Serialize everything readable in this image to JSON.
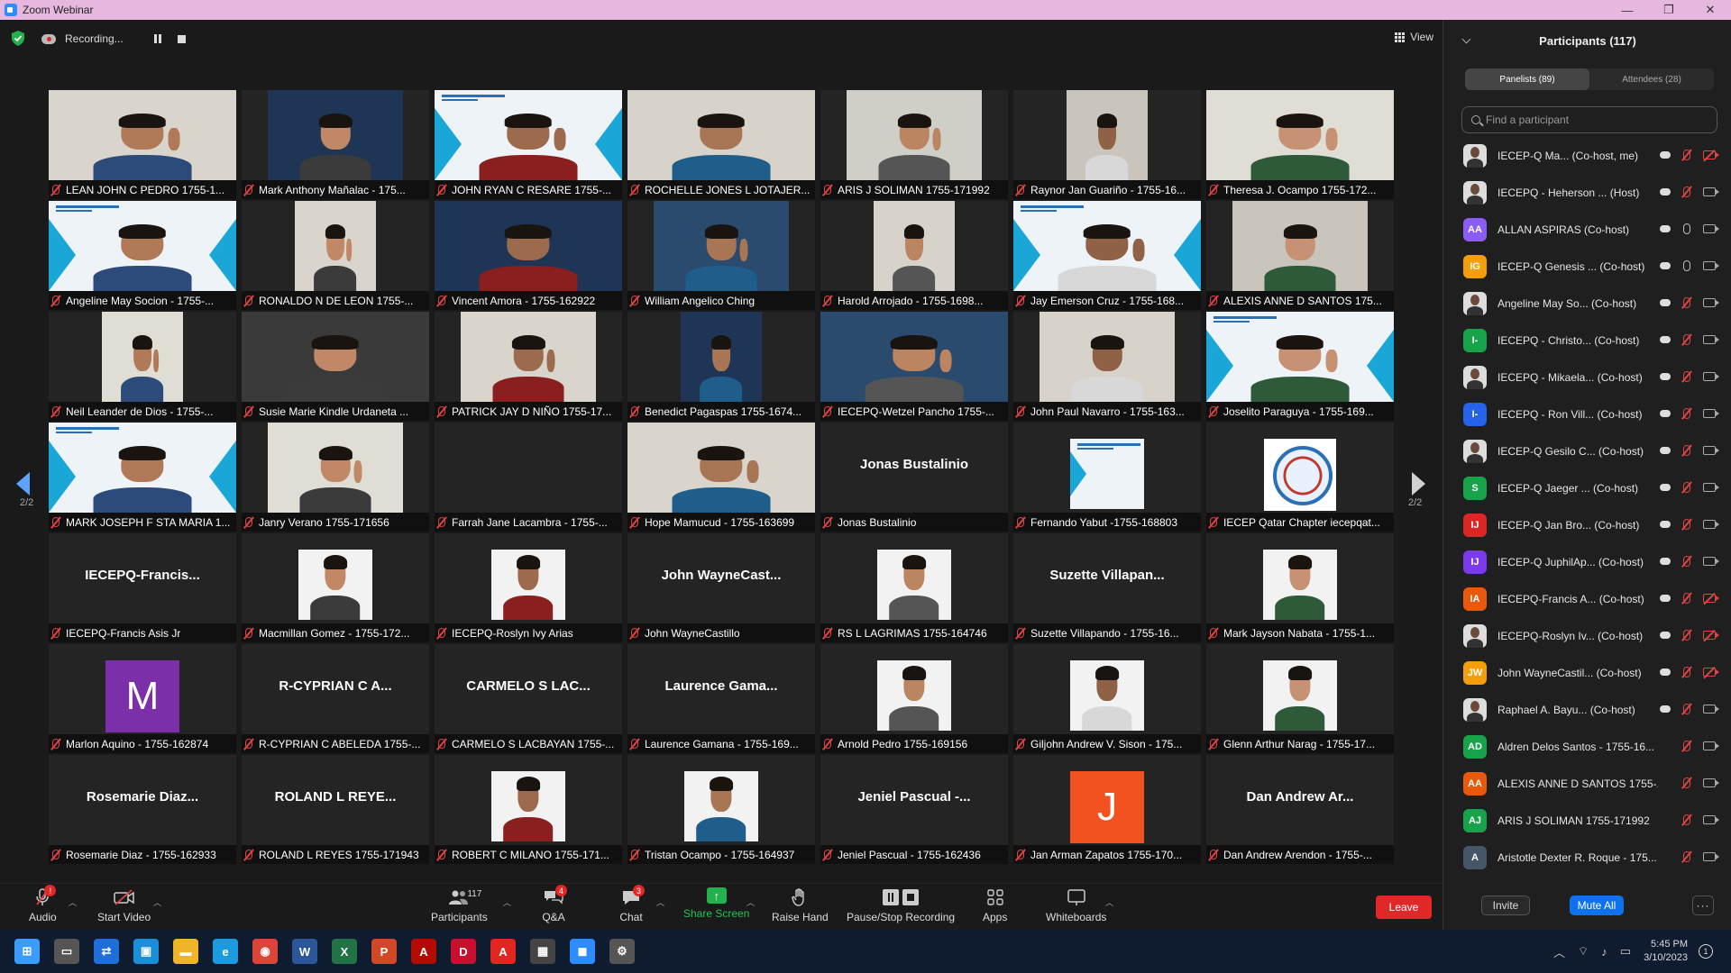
{
  "window": {
    "title": "Zoom Webinar",
    "controls": [
      "—",
      "❐",
      "✕"
    ]
  },
  "topbar": {
    "recording_label": "Recording...",
    "view_label": "View"
  },
  "pagination": {
    "left": "2/2",
    "right": "2/2"
  },
  "tiles": [
    {
      "label": "LEAN JOHN C PEDRO 1755-1...",
      "kind": "photo"
    },
    {
      "label": "Mark Anthony Mañalac - 175...",
      "kind": "photo"
    },
    {
      "label": "JOHN RYAN C RESARE 1755-...",
      "kind": "banner"
    },
    {
      "label": "ROCHELLE JONES L JOTAJER...",
      "kind": "photo"
    },
    {
      "label": "ARIS J SOLIMAN 1755-171992",
      "kind": "photo"
    },
    {
      "label": "Raynor Jan Guariño - 1755-16...",
      "kind": "photo"
    },
    {
      "label": "Theresa J. Ocampo 1755-172...",
      "kind": "photo"
    },
    {
      "label": "Angeline May Socion - 1755-...",
      "kind": "banner"
    },
    {
      "label": "RONALDO N DE LEON 1755-...",
      "kind": "photo"
    },
    {
      "label": "Vincent Amora - 1755-162922",
      "kind": "photo"
    },
    {
      "label": "William Angelico Ching",
      "kind": "photo"
    },
    {
      "label": "Harold Arrojado - 1755-1698...",
      "kind": "photo"
    },
    {
      "label": "Jay Emerson Cruz - 1755-168...",
      "kind": "banner"
    },
    {
      "label": "ALEXIS ANNE D SANTOS 175...",
      "kind": "photo"
    },
    {
      "label": "Neil Leander de Dios - 1755-...",
      "kind": "photo"
    },
    {
      "label": "Susie Marie Kindle Urdaneta ...",
      "kind": "photo"
    },
    {
      "label": "PATRICK JAY D NIÑO 1755-17...",
      "kind": "photo"
    },
    {
      "label": "Benedict Pagaspas 1755-1674...",
      "kind": "photo"
    },
    {
      "label": "IECEPQ-Wetzel Pancho 1755-...",
      "kind": "photo"
    },
    {
      "label": "John Paul Navarro - 1755-163...",
      "kind": "photo"
    },
    {
      "label": "Joselito Paraguya - 1755-169...",
      "kind": "banner"
    },
    {
      "label": "MARK JOSEPH F STA MARIA 1...",
      "kind": "banner"
    },
    {
      "label": "Janry Verano 1755-171656",
      "kind": "photo"
    },
    {
      "label": "Farrah Jane Lacambra - 1755-...",
      "kind": "blank"
    },
    {
      "label": "Hope Mamucud - 1755-163699",
      "kind": "photo"
    },
    {
      "label": "Jonas Bustalinio",
      "kind": "name",
      "display": "Jonas Bustalinio"
    },
    {
      "label": "Fernando Yabut -1755-168803",
      "kind": "banner-small"
    },
    {
      "label": "IECEP Qatar Chapter iecepqat...",
      "kind": "logo"
    },
    {
      "label": "IECEPQ-Francis Asis Jr",
      "kind": "name",
      "display": "IECEPQ-Francis..."
    },
    {
      "label": "Macmillan Gomez - 1755-172...",
      "kind": "idphoto"
    },
    {
      "label": "IECEPQ-Roslyn Ivy Arias",
      "kind": "idphoto"
    },
    {
      "label": "John WayneCastillo",
      "kind": "name",
      "display": "John WayneCast..."
    },
    {
      "label": "RS L LAGRIMAS 1755-164746",
      "kind": "idphoto"
    },
    {
      "label": "Suzette Villapando - 1755-16...",
      "kind": "name",
      "display": "Suzette Villapan..."
    },
    {
      "label": "Mark Jayson Nabata - 1755-1...",
      "kind": "idphoto"
    },
    {
      "label": "Marlon Aquino - 1755-162874",
      "kind": "letter",
      "letter": "M",
      "color": "#7b2fa8"
    },
    {
      "label": "R-CYPRIAN C ABELEDA 1755-...",
      "kind": "name",
      "display": "R-CYPRIAN C A..."
    },
    {
      "label": "CARMELO S LACBAYAN 1755-...",
      "kind": "name",
      "display": "CARMELO S LAC..."
    },
    {
      "label": "Laurence Gamana - 1755-169...",
      "kind": "name",
      "display": "Laurence Gama..."
    },
    {
      "label": "Arnold Pedro 1755-169156",
      "kind": "idphoto"
    },
    {
      "label": "Giljohn Andrew V. Sison - 175...",
      "kind": "idphoto"
    },
    {
      "label": "Glenn Arthur Narag - 1755-17...",
      "kind": "idphoto"
    },
    {
      "label": "Rosemarie Diaz - 1755-162933",
      "kind": "name",
      "display": "Rosemarie Diaz..."
    },
    {
      "label": "ROLAND L REYES 1755-171943",
      "kind": "name",
      "display": "ROLAND L REYE..."
    },
    {
      "label": "ROBERT C MILANO 1755-171...",
      "kind": "idphoto"
    },
    {
      "label": "Tristan Ocampo - 1755-164937",
      "kind": "idphoto"
    },
    {
      "label": "Jeniel Pascual - 1755-162436",
      "kind": "name",
      "display": "Jeniel Pascual -..."
    },
    {
      "label": "Jan Arman Zapatos 1755-170...",
      "kind": "letter",
      "letter": "J",
      "color": "#f2521f"
    },
    {
      "label": "Dan Andrew Arendon - 1755-...",
      "kind": "name",
      "display": "Dan Andrew Ar..."
    }
  ],
  "toolbar": {
    "audio": {
      "label": "Audio",
      "badge": "!"
    },
    "video": {
      "label": "Start Video"
    },
    "participants": {
      "label": "Participants",
      "count": "117"
    },
    "qa": {
      "label": "Q&A",
      "badge": "4"
    },
    "chat": {
      "label": "Chat",
      "badge": "3"
    },
    "share": {
      "label": "Share Screen"
    },
    "raise": {
      "label": "Raise Hand"
    },
    "rec": {
      "label": "Pause/Stop Recording"
    },
    "apps": {
      "label": "Apps"
    },
    "whiteboards": {
      "label": "Whiteboards"
    },
    "leave": "Leave"
  },
  "panel": {
    "title": "Participants (117)",
    "tabs": [
      "Panelists (89)",
      "Attendees (28)"
    ],
    "search_placeholder": "Find a participant",
    "participants": [
      {
        "name": "IECEP-Q Ma...  (Co-host, me)",
        "av": "photo",
        "mic": "off",
        "cam": "off"
      },
      {
        "name": "IECEPQ - Heherson ...  (Host)",
        "av": "photo",
        "mic": "off",
        "cam": "on"
      },
      {
        "name": "ALLAN ASPIRAS (Co-host)",
        "av": "AA",
        "color": "#8b5cf6",
        "mic": "on",
        "cam": "on"
      },
      {
        "name": "IECEP-Q Genesis ... (Co-host)",
        "av": "IG",
        "color": "#f59e0b",
        "mic": "on",
        "cam": "on"
      },
      {
        "name": "Angeline May So... (Co-host)",
        "av": "photo",
        "mic": "off",
        "cam": "on"
      },
      {
        "name": "IECEPQ - Christo... (Co-host)",
        "av": "I-",
        "color": "#16a34a",
        "mic": "off",
        "cam": "on"
      },
      {
        "name": "IECEPQ - Mikaela... (Co-host)",
        "av": "photo",
        "mic": "off",
        "cam": "on"
      },
      {
        "name": "IECEPQ - Ron Vill... (Co-host)",
        "av": "I-",
        "color": "#2563eb",
        "mic": "off",
        "cam": "on"
      },
      {
        "name": "IECEP-Q Gesilo C... (Co-host)",
        "av": "photo",
        "mic": "off",
        "cam": "on"
      },
      {
        "name": "IECEP-Q Jaeger ... (Co-host)",
        "av": "S",
        "color": "#16a34a",
        "mic": "off",
        "cam": "on"
      },
      {
        "name": "IECEP-Q Jan Bro... (Co-host)",
        "av": "IJ",
        "color": "#dc2626",
        "mic": "off",
        "cam": "on"
      },
      {
        "name": "IECEP-Q JuphilAp... (Co-host)",
        "av": "IJ",
        "color": "#7c3aed",
        "mic": "off",
        "cam": "on"
      },
      {
        "name": "IECEPQ-Francis A... (Co-host)",
        "av": "IA",
        "color": "#ea580c",
        "mic": "off",
        "cam": "off"
      },
      {
        "name": "IECEPQ-Roslyn Iv... (Co-host)",
        "av": "photo",
        "mic": "off",
        "cam": "off"
      },
      {
        "name": "John WayneCastil... (Co-host)",
        "av": "JW",
        "color": "#f59e0b",
        "mic": "off",
        "cam": "off"
      },
      {
        "name": "Raphael A. Bayu... (Co-host)",
        "av": "photo",
        "mic": "off",
        "cam": "on"
      },
      {
        "name": "Aldren Delos Santos - 1755-16...",
        "av": "AD",
        "color": "#16a34a",
        "mic": "off",
        "cam": "on"
      },
      {
        "name": "ALEXIS ANNE D SANTOS 1755-...",
        "av": "AA",
        "color": "#ea580c",
        "mic": "off",
        "cam": "on"
      },
      {
        "name": "ARIS J SOLIMAN 1755-171992",
        "av": "AJ",
        "color": "#16a34a",
        "mic": "off",
        "cam": "on"
      },
      {
        "name": "Aristotle Dexter R. Roque - 175...",
        "av": "A",
        "color": "#475569",
        "mic": "off",
        "cam": "on"
      }
    ],
    "invite": "Invite",
    "mute_all": "Mute All",
    "more": "···"
  },
  "taskbar": {
    "apps": [
      {
        "name": "windows-start",
        "glyph": "⊞",
        "color": "#3b9cff"
      },
      {
        "name": "task-view",
        "glyph": "▭",
        "color": "#555"
      },
      {
        "name": "teamviewer",
        "glyph": "⇄",
        "color": "#1e6fd9"
      },
      {
        "name": "remote",
        "glyph": "▣",
        "color": "#1a8fd8"
      },
      {
        "name": "file-explorer",
        "glyph": "▬",
        "color": "#f0b429"
      },
      {
        "name": "edge",
        "glyph": "e",
        "color": "#1d9be0"
      },
      {
        "name": "chrome",
        "glyph": "◉",
        "color": "#db4437"
      },
      {
        "name": "word",
        "glyph": "W",
        "color": "#2b579a"
      },
      {
        "name": "excel",
        "glyph": "X",
        "color": "#217346"
      },
      {
        "name": "powerpoint",
        "glyph": "P",
        "color": "#d24726"
      },
      {
        "name": "pdf",
        "glyph": "A",
        "color": "#b30b00"
      },
      {
        "name": "pdf-editor",
        "glyph": "D",
        "color": "#c8102e"
      },
      {
        "name": "acrobat",
        "glyph": "A",
        "color": "#e0261e"
      },
      {
        "name": "calculator",
        "glyph": "▦",
        "color": "#444"
      },
      {
        "name": "zoom",
        "glyph": "◼",
        "color": "#2d8cff"
      },
      {
        "name": "settings",
        "glyph": "⚙",
        "color": "#555"
      }
    ],
    "time": "5:45 PM",
    "date": "3/10/2023",
    "notif_count": "1"
  }
}
